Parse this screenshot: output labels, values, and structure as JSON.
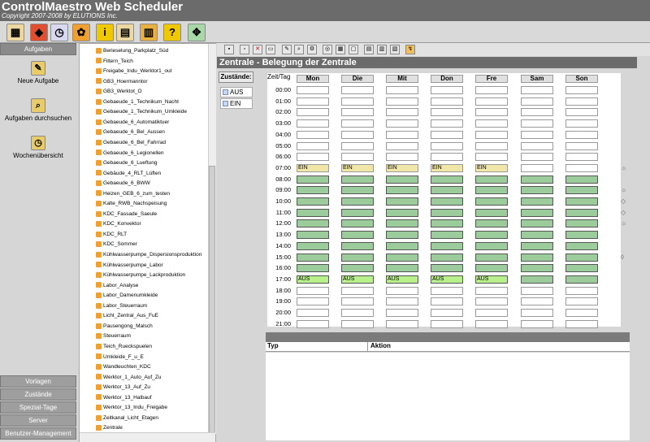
{
  "app": {
    "title": "ControlMaestro Web Scheduler",
    "copyright": "Copyright 2007-2008 by ELUTIONS Inc."
  },
  "toolbar": {
    "icons": [
      "structure-icon",
      "box-icon",
      "calendar-clock-icon",
      "gear-icon",
      "info-icon",
      "calendar-info-icon",
      "calculator-icon",
      "help-icon",
      "arrows-icon"
    ]
  },
  "sidebar": {
    "top_bar": "Aufgaben",
    "items": [
      {
        "label": "Neue Aufgabe",
        "icon": "new-task-icon"
      },
      {
        "label": "Aufgaben durchsuchen",
        "icon": "search-tasks-icon"
      },
      {
        "label": "Wochenübersicht",
        "icon": "week-icon"
      }
    ],
    "bottom_bars": [
      "Vorlagen",
      "Zustände",
      "Spezial-Tage",
      "Server",
      "Benutzer-Management"
    ]
  },
  "tree": {
    "items": [
      "Berieselung_Parkplatz_Süd",
      "Filtern_Teich",
      "Freigabe_Indu_Werktor1_out",
      "GB3_Hoermanntor",
      "GB3_Werktot_O",
      "Gebaeude_1_Technikum_Nacht",
      "Gebaeude_1_Technikum_Umkleide",
      "Gebaeude_6_Automatiktuer",
      "Gebaeude_6_Bel_Aussen",
      "Gebaeude_6_Bel_Fahrrad",
      "Gebaeude_6_Legionellen",
      "Gebaeude_6_Lueftung",
      "Gebäude_4_RLT_Lüften",
      "Gebaeude_6_BWW",
      "Heizen_GEB_6_zum_testen",
      "Kalte_RWB_Nachspeisung",
      "KDC_Fassade_Saeule",
      "KDC_Konvektor",
      "KDC_RLT",
      "KDC_Sommer",
      "Kühlwasserpumpe_Dispersionsproduktion",
      "Kühlwasserpumpe_Labor",
      "Kühlwasserpumpe_Lackproduktion",
      "Labor_Analyse",
      "Labor_Damenumkleide",
      "Labor_Steuerraum",
      "Licht_Zentral_Aus_FuE",
      "Pausengong_Malsch",
      "Steuerraum",
      "Teich_Rueckspuelen",
      "Umkleide_F_u_E",
      "Wandleuchten_KDC",
      "Werktor_1_Auto_Auf_Zu",
      "Werktor_13_Auf_Zu",
      "Werktor_13_Halbauf",
      "Werktor_13_Indu_Freigabe",
      "Zeitkanal_Licht_Etagen",
      "Zentrale"
    ]
  },
  "schedule": {
    "title": "Zentrale - Belegung der Zentrale",
    "states_label": "Zustände:",
    "states": [
      "AUS",
      "EIN"
    ],
    "corner": "Zeit/Tag",
    "days": [
      "Mon",
      "Die",
      "Mit",
      "Don",
      "Fre",
      "Sam",
      "Son"
    ],
    "times": [
      "00:00",
      "01:00",
      "02:00",
      "03:00",
      "04:00",
      "05:00",
      "06:00",
      "07:00",
      "08:00",
      "09:00",
      "10:00",
      "11:00",
      "12:00",
      "13:00",
      "14:00",
      "15:00",
      "16:00",
      "17:00",
      "18:00",
      "19:00",
      "20:00",
      "21:00"
    ],
    "ein_label": "EIN",
    "aus_label": "AUS"
  },
  "actions": {
    "col_typ": "Typ",
    "col_aktion": "Aktion"
  },
  "colors": {
    "header": "#6b6b6b",
    "ein": "#f0e6a8",
    "on": "#9ccc9c",
    "aus": "#b8f08c"
  }
}
